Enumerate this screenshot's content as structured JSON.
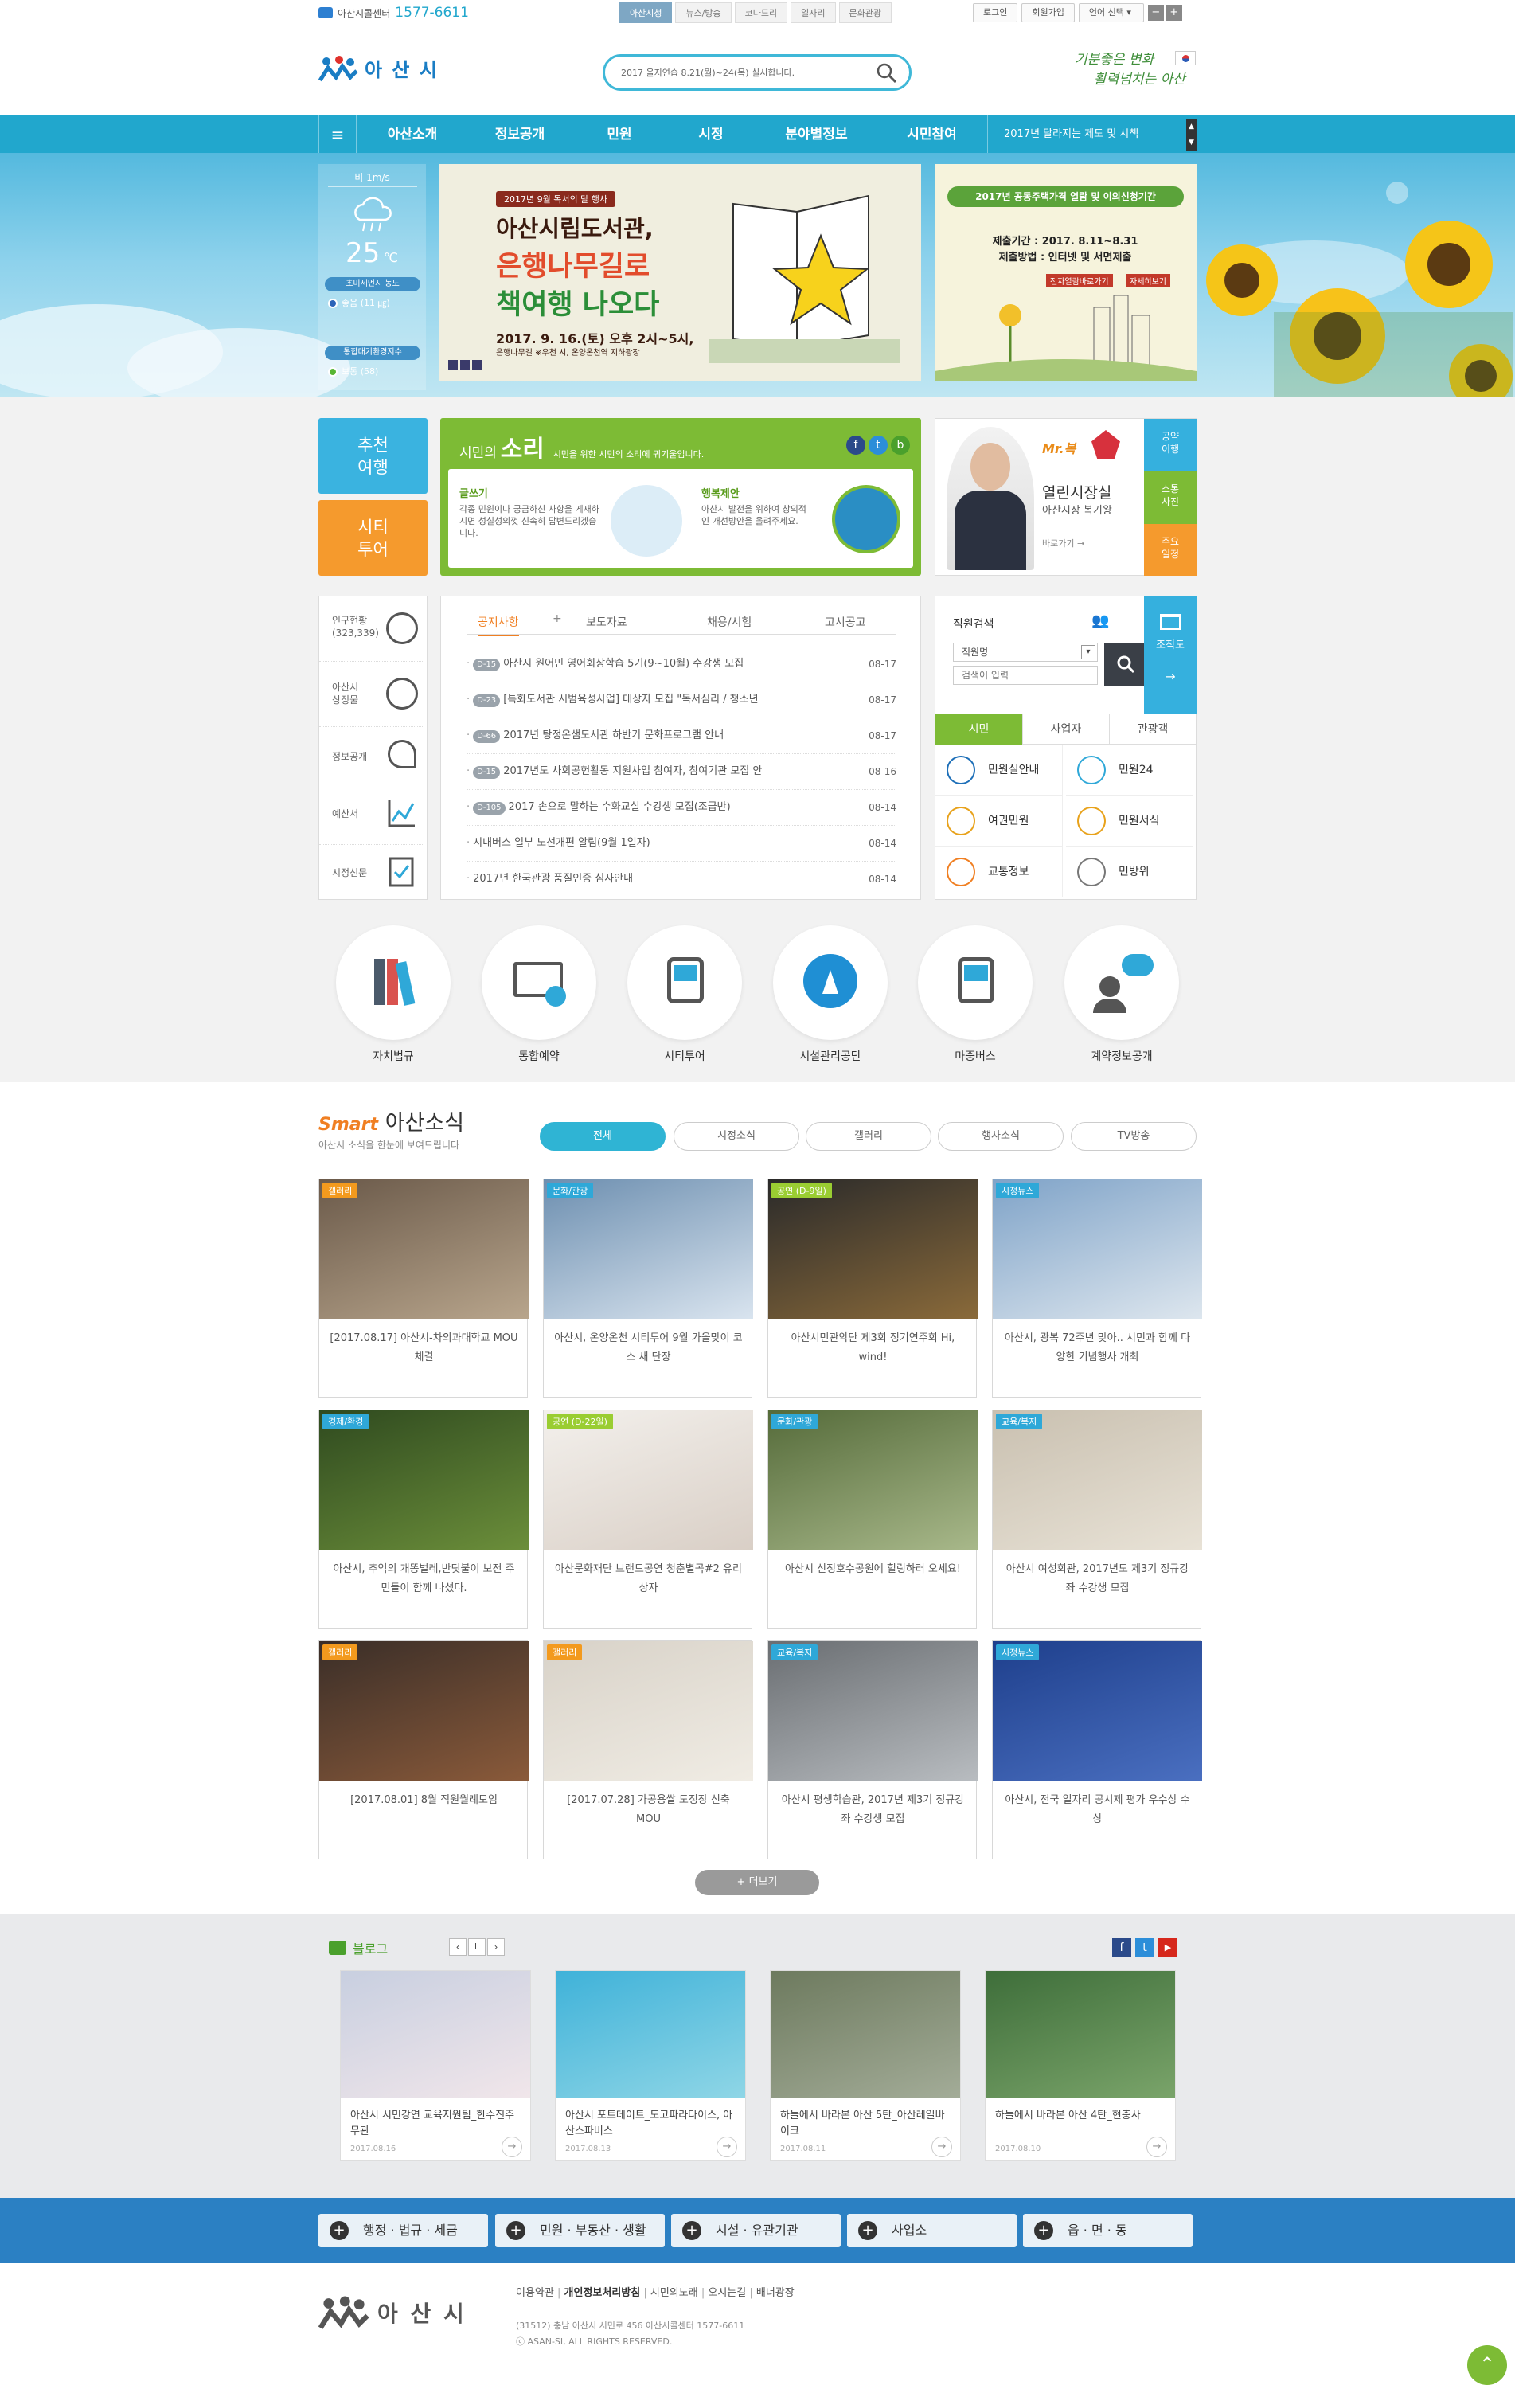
{
  "util": {
    "callcenter_label": "아산시콜센터",
    "callcenter_number": "1577-6611",
    "site_tabs": [
      "아산시청",
      "뉴스/방송",
      "코나드리",
      "일자리",
      "문화관광"
    ],
    "login": "로그인",
    "join": "회원가입",
    "lang": "언어 선택",
    "zoom_out": "−",
    "zoom_in": "+"
  },
  "header": {
    "logo": "아 산 시",
    "search_value": "2017 을지연습 8.21(월)~24(목) 실시합니다.",
    "slogan_line1": "기분좋은 변화",
    "slogan_line2": "활력넘치는 아산"
  },
  "gnb": {
    "items": [
      "아산소개",
      "정보공개",
      "민원",
      "시정",
      "분야별정보",
      "시민참여"
    ],
    "notice": "2017년 달라지는 제도 및 시책"
  },
  "weather": {
    "wind": "비 1m/s",
    "temp": "25",
    "unit": "℃",
    "dust_title": "초미세먼지 농도",
    "dust_value": "좋음 (11 ㎍)",
    "air_title": "통합대기환경지수",
    "air_value": "보통 (58)"
  },
  "banner_main": {
    "badge": "2017년 9월 독서의 달 행사",
    "line1": "아산시립도서관,",
    "line2": "은행나무길로",
    "line3": "책여행 나오다",
    "date": "2017. 9. 16.(토) 오후 2시~5시,",
    "place": "은행나무길 ※우천 시, 온양온천역 지하광장"
  },
  "banner_side": {
    "title": "2017년 공동주택가격 열람 및 이의신청기간",
    "period": "제출기간 : 2017. 8.11~8.31",
    "method": "제출방법 : 인터넷 및 서면제출",
    "btn1": "전자열람바로가기",
    "btn2": "자세히보기"
  },
  "quick_left": {
    "travel": "추천\n여행",
    "tour": "시티\n투어"
  },
  "voice": {
    "prefix": "시민의",
    "title": "소리",
    "subtitle": "시민을 위한 시민의 소리에 귀기울입니다.",
    "item1_title": "글쓰기",
    "item1_desc": "각종 민원이나 궁금하신 사항을 게재하시면 성실성의껏 신속히 답변드리겠습니다.",
    "item2_title": "행복제안",
    "item2_desc": "아산시 발전을 위하여 창의적인 개선방안을 올려주세요."
  },
  "mayor": {
    "brand": "Mr.복",
    "title": "열린시장실",
    "name": "아산시장 복기왕",
    "link": "바로가기 →",
    "side": [
      "공약\n이행",
      "소통\n사진",
      "주요\n일정"
    ]
  },
  "side_links": [
    "인구현황\n(323,339)",
    "아산시\n상징물",
    "정보공개",
    "예산서",
    "시정신문"
  ],
  "notice": {
    "tabs": [
      "공지사항",
      "보도자료",
      "채용/시험",
      "고시공고"
    ],
    "more": "+",
    "rows": [
      {
        "badge": "D-15",
        "text": "아산시 원어민 영어회상학습 5기(9~10월) 수강생 모집",
        "date": "08-17"
      },
      {
        "badge": "D-23",
        "text": "[특화도서관 시범육성사업] 대상자 모집 \"독서심리 / 청소년",
        "date": "08-17"
      },
      {
        "badge": "D-66",
        "text": "2017년 탕정온샘도서관 하반기 문화프로그램 안내",
        "date": "08-17"
      },
      {
        "badge": "D-15",
        "text": "2017년도 사회공헌활동 지원사업 참여자, 참여기관 모집 안",
        "date": "08-16"
      },
      {
        "badge": "D-105",
        "text": "2017 손으로 말하는 수화교실 수강생 모집(조급반)",
        "date": "08-14"
      },
      {
        "badge": "",
        "text": "시내버스 일부 노선개편 알림(9월 1일자)",
        "date": "08-14"
      },
      {
        "badge": "",
        "text": "2017년 한국관광 품질인증 심사안내",
        "date": "08-14"
      }
    ]
  },
  "staff": {
    "title": "직원검색",
    "select": "직원명",
    "placeholder": "검색어 입력",
    "org": "조직도"
  },
  "svc": {
    "tabs": [
      "시민",
      "사업자",
      "관광객"
    ],
    "items": [
      "민원실안내",
      "민원24",
      "여권민원",
      "민원서식",
      "교통정보",
      "민방위"
    ]
  },
  "quick_circles": [
    "자치법규",
    "통합예약",
    "시티투어",
    "시설관리공단",
    "마중버스",
    "계약정보공개"
  ],
  "news": {
    "smart": "Smart",
    "title": "아산소식",
    "subtitle": "아산시 소식을 한눈에 보여드립니다",
    "filters": [
      "전체",
      "시정소식",
      "갤러리",
      "행사소식",
      "TV방송"
    ],
    "more": "+ 더보기",
    "cards": [
      {
        "tag": "갤러리",
        "text": "[2017.08.17] 아산시-차의과대학교 MOU체결",
        "color": "#f39a1e"
      },
      {
        "tag": "문화/관광",
        "text": "아산시, 온양온천 시티투어 9월 가을맞이 코스 새 단장",
        "color": "#2fa8d8"
      },
      {
        "tag": "공연 (D-9일)",
        "text": "아산시민관악단 제3회 정기연주회 Hi, wind!",
        "color": "#9acd32"
      },
      {
        "tag": "시정뉴스",
        "text": "아산시, 광복 72주년 맞아.. 시민과 함께 다양한 기념행사 개최",
        "color": "#2fa8d8"
      },
      {
        "tag": "경제/환경",
        "text": "아산시, 추억의 개똥벌레,반딧불이 보전 주민들이 함께 나섰다.",
        "color": "#2fa8d8"
      },
      {
        "tag": "공연 (D-22일)",
        "text": "아산문화재단 브랜드공연 청춘별곡#2 유리상자",
        "color": "#9acd32"
      },
      {
        "tag": "문화/관광",
        "text": "아산시 신정호수공원에 힐링하러 오세요!",
        "color": "#2fa8d8"
      },
      {
        "tag": "교육/복지",
        "text": "아산시 여성회관, 2017년도 제3기 정규강좌 수강생 모집",
        "color": "#2fa8d8"
      },
      {
        "tag": "갤러리",
        "text": "[2017.08.01] 8월 직원월례모임",
        "color": "#f39a1e"
      },
      {
        "tag": "갤러리",
        "text": "[2017.07.28] 가공용쌀 도정장 신축 MOU",
        "color": "#f39a1e"
      },
      {
        "tag": "교육/복지",
        "text": "아산시 평생학습관, 2017년 제3기 정규강좌 수강생 모집",
        "color": "#2fa8d8"
      },
      {
        "tag": "시정뉴스",
        "text": "아산시, 전국 일자리 공시제 평가 우수상 수상",
        "color": "#2fa8d8"
      }
    ]
  },
  "blog": {
    "title": "블로그",
    "controls": [
      "‹",
      "II",
      "›"
    ],
    "sns": [
      "f",
      "t",
      "▶"
    ],
    "cards": [
      {
        "text": "아산시 시민강연 교육지원팀_한수진주무관",
        "date": "2017.08.16"
      },
      {
        "text": "아산시 포트데이트_도고파라다이스, 아산스파비스",
        "date": "2017.08.13"
      },
      {
        "text": "하늘에서 바라본 아산 5탄_아산레일바이크",
        "date": "2017.08.11"
      },
      {
        "text": "하늘에서 바라본 아산 4탄_현충사",
        "date": "2017.08.10"
      }
    ]
  },
  "footer_quick": [
    "행정 · 법규 · 세금",
    "민원 · 부동산 · 생활",
    "시설 · 유관기관",
    "사업소",
    "읍 · 면 · 동"
  ],
  "footer": {
    "logo": "아 산 시",
    "links": [
      "이용약관",
      "개인정보처리방침",
      "시민의노래",
      "오시는길",
      "배너광장"
    ],
    "address": "(31512) 충남 아산시 시민로 456 아산시콜센터 1577-6611",
    "copy": "ⓒ ASAN-SI, ALL RIGHTS RESERVED."
  }
}
